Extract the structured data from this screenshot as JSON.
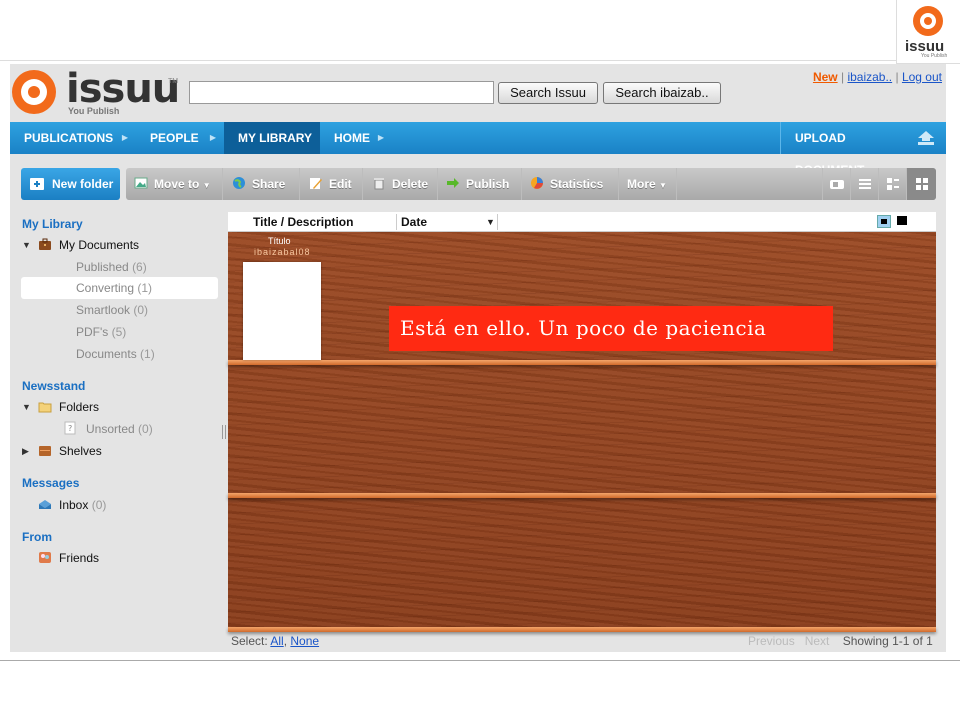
{
  "corner_logo": {
    "word": "issuu",
    "tagline": "You Publish"
  },
  "header": {
    "logo_word": "issuu",
    "logo_tm": "TM",
    "logo_tagline": "You Publish",
    "search_value": "",
    "search_issuu_label": "Search Issuu",
    "search_user_label": "Search ibaizab..",
    "links": {
      "new": "New",
      "sep": "|",
      "user": "ibaizab..",
      "logout": "Log out"
    }
  },
  "nav": {
    "items": [
      "PUBLICATIONS",
      "PEOPLE",
      "MY LIBRARY",
      "HOME"
    ],
    "upload": "UPLOAD DOCUMENT"
  },
  "toolbar": {
    "new_folder": "New folder",
    "buttons": [
      "Move to",
      "Share",
      "Edit",
      "Delete",
      "Publish",
      "Statistics",
      "More"
    ]
  },
  "sidebar": {
    "my_library": "My Library",
    "my_documents": "My Documents",
    "doc_items": [
      {
        "label": "Published",
        "count": "(6)"
      },
      {
        "label": "Converting",
        "count": "(1)"
      },
      {
        "label": "Smartlook",
        "count": "(0)"
      },
      {
        "label": "PDF's",
        "count": "(5)"
      },
      {
        "label": "Documents",
        "count": "(1)"
      }
    ],
    "newsstand": "Newsstand",
    "folders": "Folders",
    "unsorted": {
      "label": "Unsorted",
      "count": "(0)"
    },
    "shelves": "Shelves",
    "messages": "Messages",
    "inbox": {
      "label": "Inbox",
      "count": "(0)"
    },
    "from": "From",
    "friends": "Friends"
  },
  "content": {
    "col_title": "Title / Description",
    "col_date": "Date",
    "doc_title": "Título",
    "doc_owner": "ibaizabal08",
    "note": "Está en ello. Un poco de paciencia"
  },
  "footer": {
    "select_label": "Select:",
    "all": "All",
    "comma": ",",
    "none": "None",
    "previous": "Previous",
    "next": "Next",
    "showing": "Showing 1-1 of 1"
  },
  "colors": {
    "accent": "#1f8fd6",
    "brand": "#f26a1b",
    "note_bg": "#ff2a12"
  }
}
